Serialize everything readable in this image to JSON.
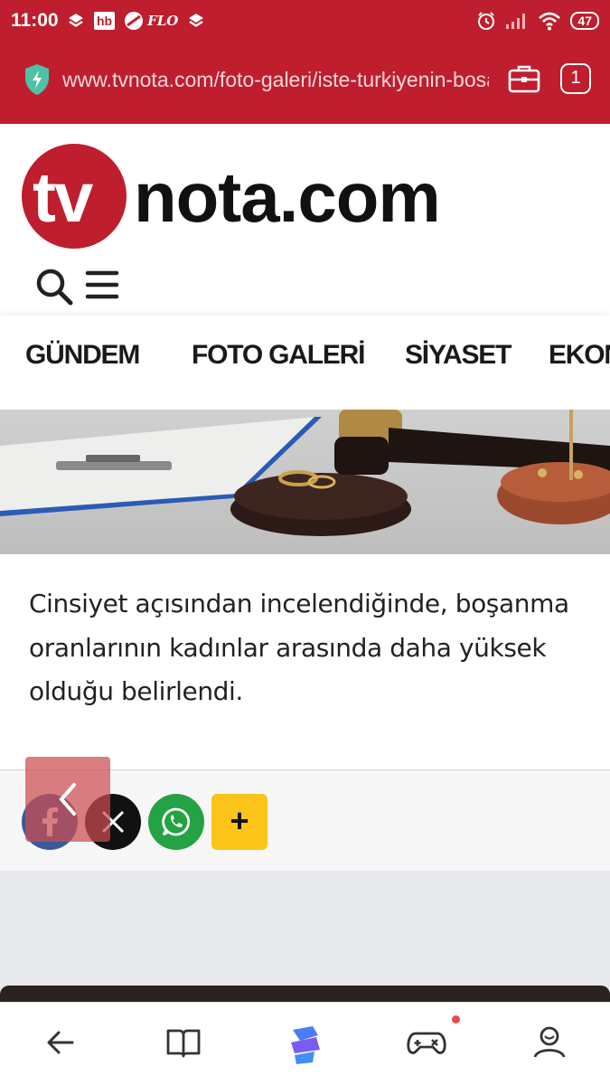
{
  "status_bar": {
    "time": "11:00",
    "left_icons": [
      "layers-icon",
      "hb-icon",
      "flo-icon",
      "layers-icon"
    ],
    "hb_label": "hb",
    "flo_label": "FLO",
    "right_icons": [
      "alarm-icon",
      "signal-icon",
      "wifi-icon",
      "battery-icon"
    ],
    "battery": "47"
  },
  "browser": {
    "url": "www.tvnota.com/foto-galeri/iste-turkiyenin-bosanma-haritasi",
    "secure_icon": "shield-bolt-icon",
    "tools_icon": "briefcase-icon",
    "tab_count": "1"
  },
  "site": {
    "logo_tv": "tv",
    "logo_rest": "nota.com",
    "search_icon": "search-icon",
    "menu_icon": "hamburger-icon"
  },
  "categories": [
    "GÜNDEM",
    "FOTO GALERİ",
    "SİYASET",
    "EKONOMİ"
  ],
  "article": {
    "hero_image": "gavel-and-wedding-rings-photo",
    "text": "Cinsiyet açısından incelendiğinde, boşanma oranlarının kadınlar arasında daha yüksek olduğu belirlendi."
  },
  "share": {
    "buttons": [
      "facebook-icon",
      "x-icon",
      "whatsapp-icon"
    ],
    "more_label": "+",
    "back_icon": "chevron-left-icon"
  },
  "bottom_nav": {
    "items": [
      "back-arrow-icon",
      "book-icon",
      "browser-logo-icon",
      "gamepad-icon",
      "profile-icon"
    ]
  },
  "colors": {
    "brand_red": "#be1e2d",
    "facebook": "#3b5998",
    "whatsapp": "#25a244",
    "more_yellow": "#fcc419"
  }
}
